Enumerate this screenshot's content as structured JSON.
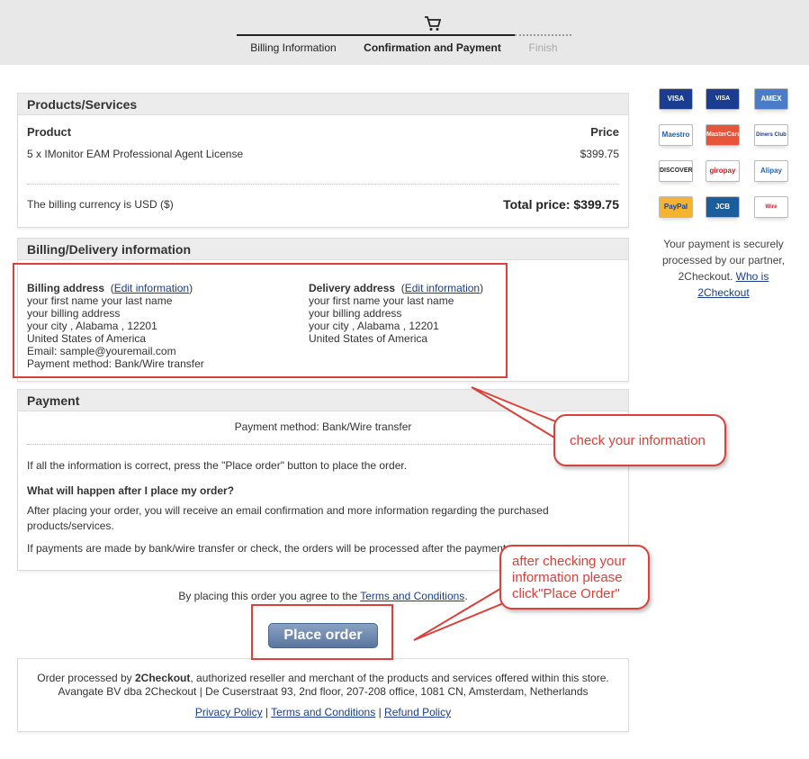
{
  "steps": {
    "billing": "Billing Information",
    "confirmation": "Confirmation and Payment",
    "finish": "Finish"
  },
  "products": {
    "title": "Products/Services",
    "col_product": "Product",
    "col_price": "Price",
    "item_name": "5 x IMonitor EAM Professional Agent License",
    "item_price": "$399.75",
    "currency_note": "The billing currency is USD ($)",
    "total": "Total price: $399.75"
  },
  "billing_info": {
    "title": "Billing/Delivery information",
    "billing_label": "Billing address",
    "delivery_label": "Delivery address",
    "edit_link": "Edit information",
    "billing_lines": [
      "your first name your last name",
      "your billing address",
      "your city , Alabama , 12201",
      "United States of America",
      "Email: sample@youremail.com",
      "Payment method: Bank/Wire transfer"
    ],
    "delivery_lines": [
      "your first name your last name",
      "your billing address",
      "your city , Alabama , 12201",
      "United States of America"
    ]
  },
  "payment": {
    "title": "Payment",
    "method": "Payment method: Bank/Wire transfer",
    "instruction": "If all the information is correct, press the \"Place order\" button to place the order.",
    "question": "What will happen after I place my order?",
    "after_text": "After placing your order, you will receive an email confirmation and more information regarding the purchased products/services.",
    "bank_text": "If payments are made by bank/wire transfer or check, the orders will be processed after the payment"
  },
  "agree": {
    "prefix": "By placing this order you agree to the",
    "link": "Terms and Conditions",
    "suffix": "."
  },
  "place_order": "Place order",
  "footer": {
    "line1_prefix": "Order processed by",
    "line1_brand": "2Checkout",
    "line1_suffix": ", authorized reseller and merchant of the products and services offered within this store.",
    "line2": "Avangate BV dba 2Checkout | De Cuserstraat 93, 2nd floor, 207-208 office, 1081 CN, Amsterdam, Netherlands",
    "privacy": "Privacy Policy",
    "terms": "Terms and Conditions",
    "refund": "Refund Policy",
    "sep": "|"
  },
  "sidebar": {
    "cards": [
      "VISA",
      "VISA Electron",
      "AMEX",
      "Maestro",
      "MasterCard",
      "Diners Club",
      "DISCOVER",
      "giropay",
      "Alipay",
      "PayPal",
      "JCB",
      "Wire Transfer"
    ],
    "secure_text": "Your payment is securely processed by our partner, 2Checkout.",
    "who_link": "Who is 2Checkout"
  },
  "annotations": {
    "check_info": "check your information",
    "after_check": "after checking your information please click\"Place Order\""
  },
  "colors": {
    "annotation_red": "#d9413a",
    "button_blue": "#5a769f"
  }
}
